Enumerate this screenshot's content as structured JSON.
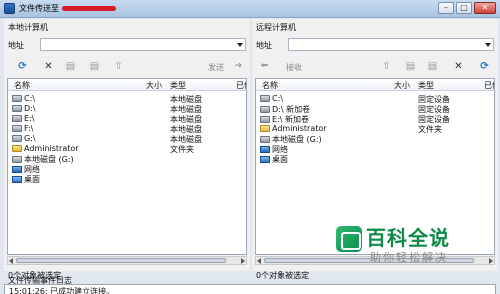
{
  "window": {
    "title": "文件传送至",
    "minimize_glyph": "–",
    "maximize_glyph": "□",
    "close_glyph": "✕"
  },
  "left_pane": {
    "section_title": "本地计算机",
    "address_label": "地址",
    "address_value": "",
    "toolbar": {
      "send_label": "发送"
    },
    "columns": {
      "name": "名称",
      "size": "大小",
      "type": "类型",
      "modified": "已修"
    },
    "items": [
      {
        "name": "C:\\",
        "type": "本地磁盘",
        "icon": "drive-icon"
      },
      {
        "name": "D:\\",
        "type": "本地磁盘",
        "icon": "drive-icon"
      },
      {
        "name": "E:\\",
        "type": "本地磁盘",
        "icon": "drive-icon"
      },
      {
        "name": "F:\\",
        "type": "本地磁盘",
        "icon": "drive-icon"
      },
      {
        "name": "G:\\",
        "type": "本地磁盘",
        "icon": "drive-icon"
      },
      {
        "name": "Administrator",
        "type": "文件夹",
        "icon": "folder-icon"
      },
      {
        "name": "本地磁盘 (G:)",
        "type": "",
        "icon": "drive-icon"
      },
      {
        "name": "网络",
        "type": "",
        "icon": "network-icon"
      },
      {
        "name": "桌面",
        "type": "",
        "icon": "desktop-icon"
      }
    ],
    "status": "0个对象被选定"
  },
  "right_pane": {
    "section_title": "远程计算机",
    "address_label": "地址",
    "address_value": "",
    "toolbar": {
      "receive_label": "接收"
    },
    "columns": {
      "name": "名称",
      "size": "大小",
      "type": "类型",
      "modified": "已修"
    },
    "items": [
      {
        "name": "C:\\",
        "type": "固定设备",
        "icon": "drive-icon"
      },
      {
        "name": "D:\\ 新加卷",
        "type": "固定设备",
        "icon": "drive-icon"
      },
      {
        "name": "E:\\ 新加卷",
        "type": "固定设备",
        "icon": "drive-icon"
      },
      {
        "name": "Administrator",
        "type": "文件夹",
        "icon": "folder-icon"
      },
      {
        "name": "本地磁盘 (G:)",
        "type": "",
        "icon": "drive-icon"
      },
      {
        "name": "网络",
        "type": "",
        "icon": "network-icon"
      },
      {
        "name": "桌面",
        "type": "",
        "icon": "desktop-icon"
      }
    ],
    "status": "0个对象被选定"
  },
  "log": {
    "label": "文件传输事件日志",
    "line": "15:01:26: 已成功建立连接。"
  },
  "watermark": {
    "title": "百科全说",
    "subtitle": "助你轻松解决"
  },
  "colors": {
    "title_mask": "#d51b25",
    "watermark_green": "#0d8a45",
    "toolbar_blue": "#1d73c9"
  }
}
